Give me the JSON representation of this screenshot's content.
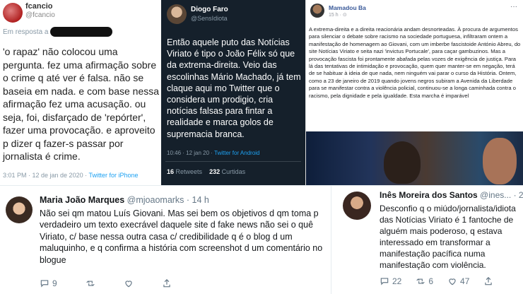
{
  "tweet1": {
    "name": "fcancio",
    "handle": "@fcancio",
    "reply_prefix": "Em resposta a",
    "text": "'o rapaz' não colocou uma pergunta. fez uma afirmação sobre o crime q até ver é falsa. não se baseia em nada. e com base nessa afirmação fez uma acusação. ou seja, foi, disfarçado de 'repórter', fazer uma provocação. e aproveito p dizer q fazer-s passar por jornalista é crime.",
    "timestamp": "3:01 PM · 12 de jan de 2020 ·",
    "source": "Twitter for iPhone"
  },
  "tweet2": {
    "name": "Diogo Faro",
    "handle": "@SensIdiota",
    "text": "Então aquele puto das Notícias Viriato é tipo o João Félix só que da extrema-direita. Veio das escolinhas Mário Machado, já tem claque aqui mo Twitter que o considera um prodigio, cria notícias falsas para fintar a realidade e marca golos de supremacia branca.",
    "timestamp": "10:46 · 12 jan 20 ·",
    "source": "Twitter for Android",
    "retweets_count": "16",
    "retweets_label": "Retweets",
    "likes_count": "232",
    "likes_label": "Curtidas"
  },
  "fbpost": {
    "name": "Mamadou Ba",
    "time": "15 h · ⊙",
    "more": "···",
    "text": "A extrema-direita e a direita reacionária andam desnorteadas. À procura de argumentos para silenciar o debate sobre racismo na sociedade portuguesa, infiltraram ontem a manifestação de homenagem ao Giovani, com um imberbe fascistoide António Abreu, do site Notícias Viriato e seita nazi 'invictus Portucale', para caçar gambuzinos. Mas a provocação fascista foi prontamente abafada pelas vozes de exigência de justiça. Para lá das tentativas de intimidação e provocação, quem quer manter-se em negação, terá de se habituar à ideia de que nada, nem ninguém vai parar o curso da História. Ontem, como a 23 de janeiro de 2019 quando jovens negros subiram a Avenida da Liberdade para se manifestar contra a violência policial, continuou-se a longa caminhada contra o racismo, pela dignidade e pela igualdade. Esta marcha é imparável"
  },
  "tweet4": {
    "name": "Maria João Marques",
    "handle": "@mjoaomarks · 14 h",
    "text": "Não sei qm matou Luís Giovani. Mas sei bem os objetivos d qm toma p verdadeiro um texto execrável daquele site d fake news não sei o quê Viriato, c/ base nessa outra casa c/ credibilidade q é o blog d um maluquinho, e q confirma a história com screenshot d um comentário no blogue",
    "replies": "9",
    "retweets": "",
    "likes": ""
  },
  "tweet5": {
    "name": "Inês Moreira dos Santos",
    "handle": "@ines... · 2h",
    "text": "Desconfio q o miúdo/jornalista/idiota das Notícias Viriato é 1 fantoche de alguém mais poderoso, q estava interessado em transformar a manifestação pacífica numa manifestação com violência.",
    "replies": "22",
    "retweets": "6",
    "likes": "47"
  },
  "colors": {
    "dark_bg": "#15202b",
    "twitter_blue": "#1da1f2",
    "fb_blue": "#385898"
  }
}
